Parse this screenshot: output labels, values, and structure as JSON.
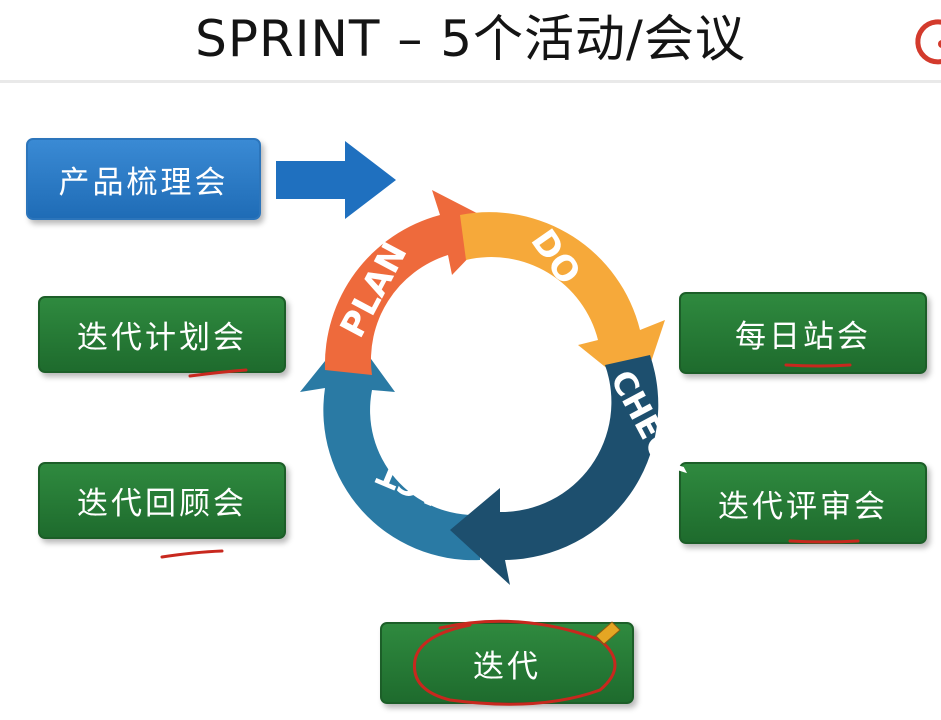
{
  "title": "SPRINT – 5个活动/会议",
  "boxes": {
    "product_backlog": "产品梳理会",
    "sprint_planning": "迭代计划会",
    "sprint_retrospective": "迭代回顾会",
    "daily_standup": "每日站会",
    "sprint_review": "迭代评审会",
    "sprint": "迭代"
  },
  "cycle": {
    "plan": "PLAN",
    "do": "DO",
    "check": "CHECK",
    "act": "ACT"
  },
  "colors": {
    "blue_box": "#2a78c2",
    "green_box": "#237535",
    "arrow_blue": "#1e6fbf",
    "plan": "#ee6a3c",
    "do": "#f6a93a",
    "check": "#1d4f6e",
    "act": "#2a7aa4",
    "annotation_red": "#c8281e"
  }
}
